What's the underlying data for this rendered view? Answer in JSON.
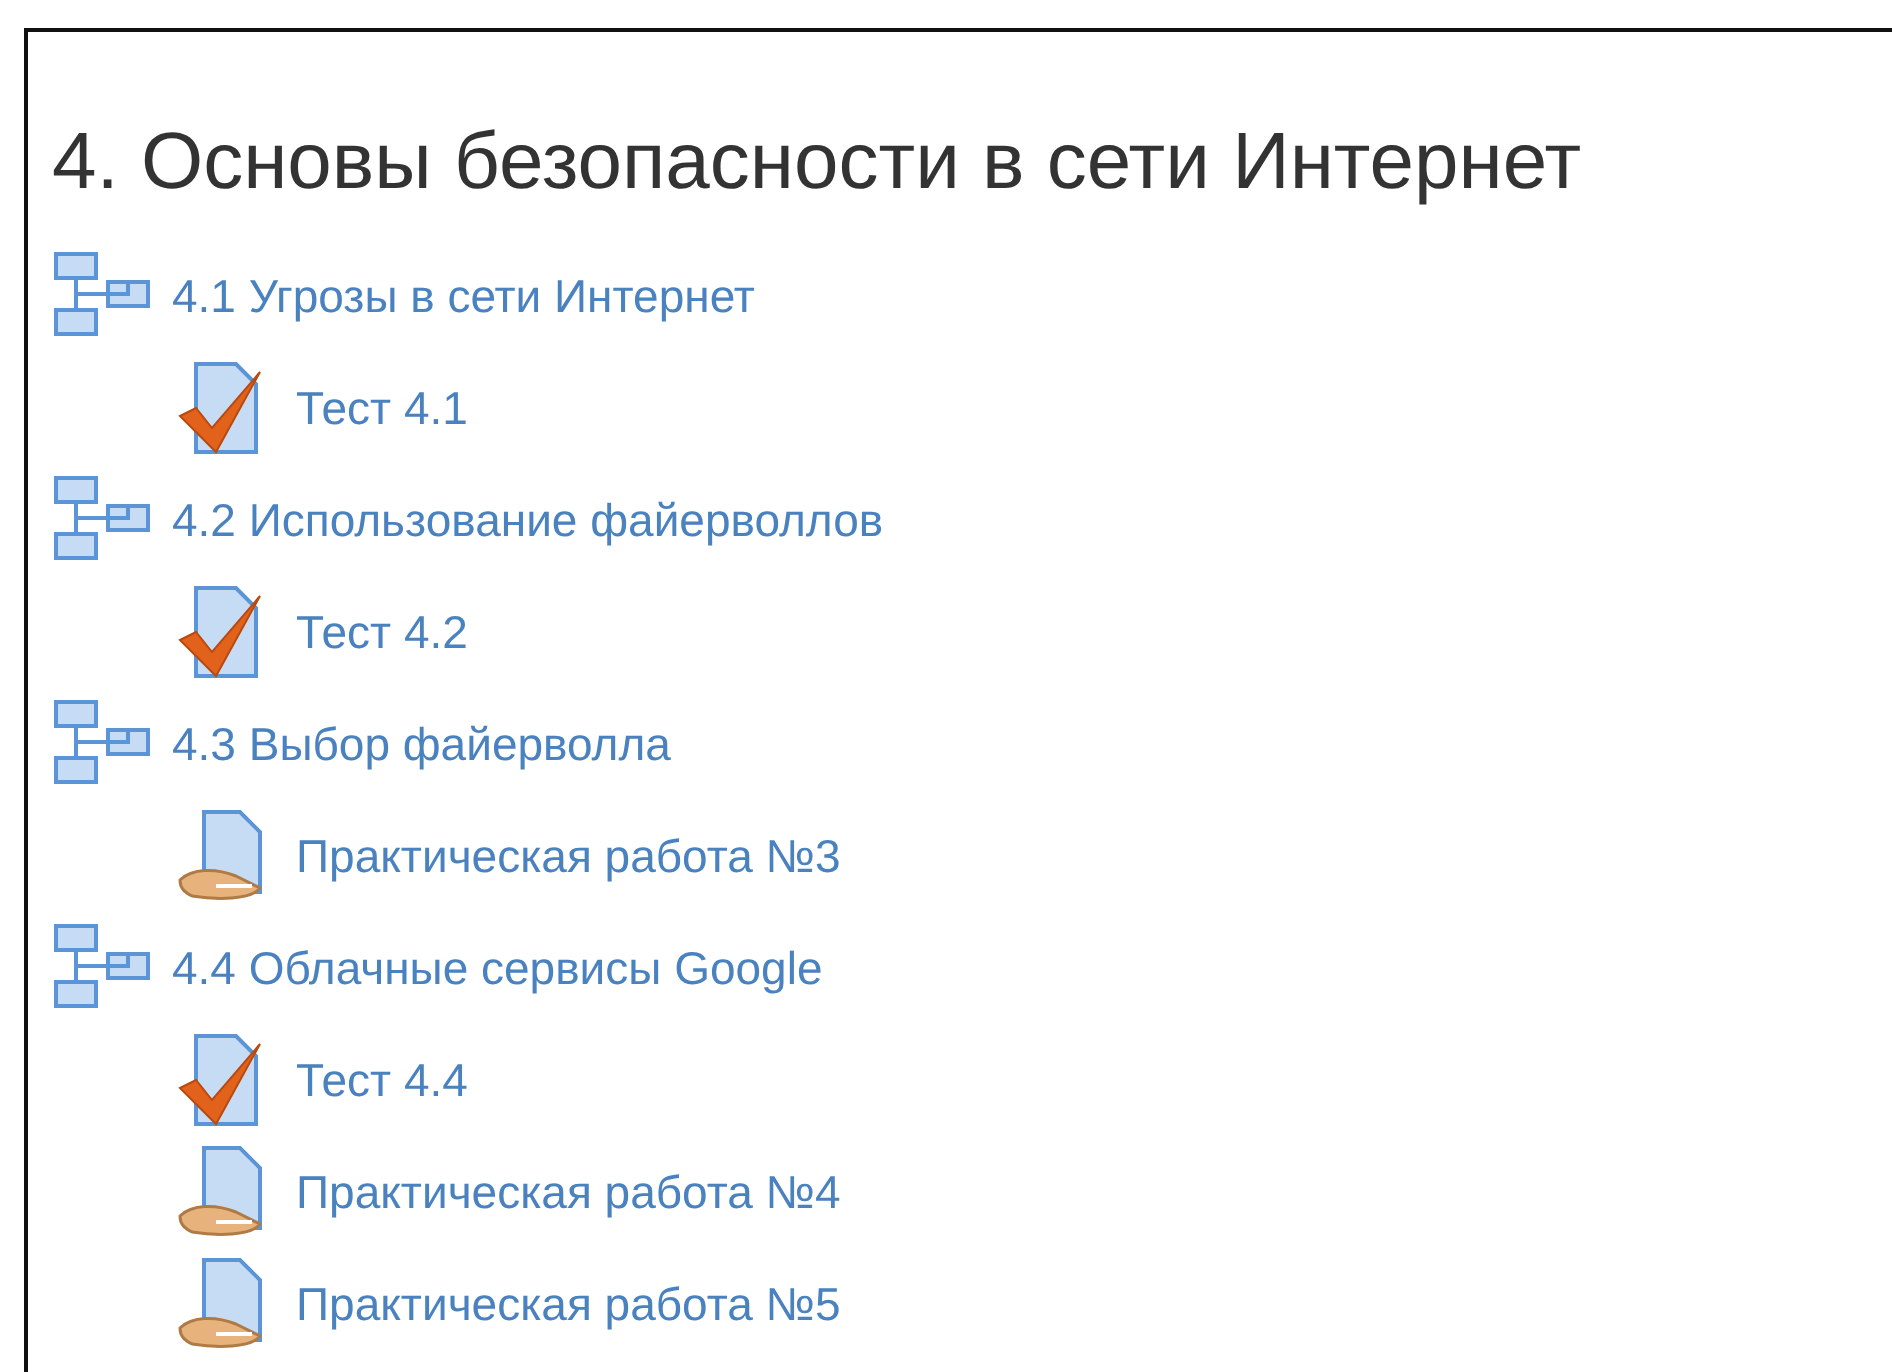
{
  "section_title": "4. Основы безопасности в сети Интернет",
  "items": [
    {
      "kind": "lesson",
      "label": "4.1 Угрозы в сети Интернет",
      "children": [
        {
          "kind": "quiz",
          "label": "Тест 4.1"
        }
      ]
    },
    {
      "kind": "lesson",
      "label": "4.2 Использование файерволлов",
      "children": [
        {
          "kind": "quiz",
          "label": "Тест 4.2"
        }
      ]
    },
    {
      "kind": "lesson",
      "label": "4.3 Выбор файерволла",
      "children": [
        {
          "kind": "assignment",
          "label": "Практическая работа №3"
        }
      ]
    },
    {
      "kind": "lesson",
      "label": "4.4 Облачные сервисы Google",
      "children": [
        {
          "kind": "quiz",
          "label": "Тест 4.4"
        },
        {
          "kind": "assignment",
          "label": "Практическая работа №4"
        },
        {
          "kind": "assignment",
          "label": "Практическая работа №5"
        }
      ]
    }
  ]
}
